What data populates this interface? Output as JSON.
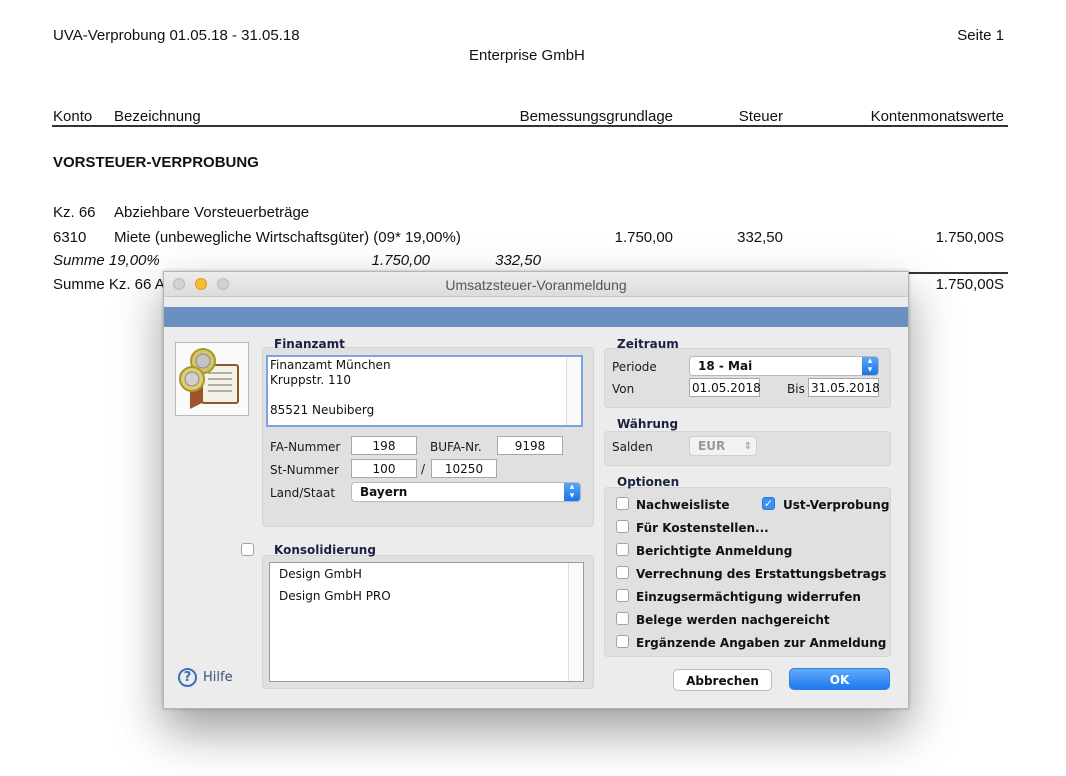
{
  "report": {
    "header_left": "UVA-Verprobung 01.05.18 - 31.05.18",
    "header_right": "Seite 1",
    "company": "Enterprise GmbH",
    "columns": [
      "Konto",
      "Bezeichnung",
      "Bemessungsgrundlage",
      "Steuer",
      "Kontenmonatswerte"
    ],
    "section_title": "VORSTEUER-VERPROBUNG",
    "group_kz": "Kz. 66",
    "group_label": "Abziehbare Vorsteuerbeträge",
    "row": {
      "konto": "6310",
      "bezeichnung": "Miete (unbewegliche Wirtschaftsgüter) (09* 19,00%)",
      "bemessung": "1.750,00",
      "steuer": "332,50",
      "wert": "1.750,00S"
    },
    "summe_rate": {
      "label": "Summe 19,00%",
      "bemessung": "1.750,00",
      "steuer": "332,50"
    },
    "summe_kz": {
      "label": "Summe Kz. 66 A",
      "wert": "1.750,00S"
    }
  },
  "dialog": {
    "title": "Umsatzsteuer-Voranmeldung",
    "finanzamt": {
      "section": "Finanzamt",
      "address": [
        "Finanzamt München",
        "Kruppstr. 110",
        "",
        "85521 Neubiberg"
      ],
      "fa_nummer_label": "FA-Nummer",
      "fa_nummer": "198",
      "bufa_label": "BUFA-Nr.",
      "bufa": "9198",
      "st_nummer_label": "St-Nummer",
      "st_nummer_1": "100",
      "st_sep": "/",
      "st_nummer_2": "10250",
      "land_label": "Land/Staat",
      "land": "Bayern"
    },
    "konsolidierung": {
      "section": "Konsolidierung",
      "items": [
        "Design GmbH",
        "Design GmbH PRO"
      ]
    },
    "zeitraum": {
      "section": "Zeitraum",
      "periode_label": "Periode",
      "periode": "18 - Mai",
      "von_label": "Von",
      "von": "01.05.2018",
      "bis_label": "Bis",
      "bis": "31.05.2018"
    },
    "waehrung": {
      "section": "Währung",
      "salden_label": "Salden",
      "salden": "EUR"
    },
    "optionen": {
      "section": "Optionen",
      "nachweisliste": "Nachweisliste",
      "ust_verprobung": "Ust-Verprobung",
      "items": [
        "Für Kostenstellen...",
        "Berichtigte Anmeldung",
        "Verrechnung des Erstattungsbetrags",
        "Einzugsermächtigung widerrufen",
        "Belege werden nachgereicht",
        "Ergänzende Angaben zur Anmeldung"
      ]
    },
    "help_label": "Hilfe",
    "cancel_label": "Abbrechen",
    "ok_label": "OK"
  }
}
